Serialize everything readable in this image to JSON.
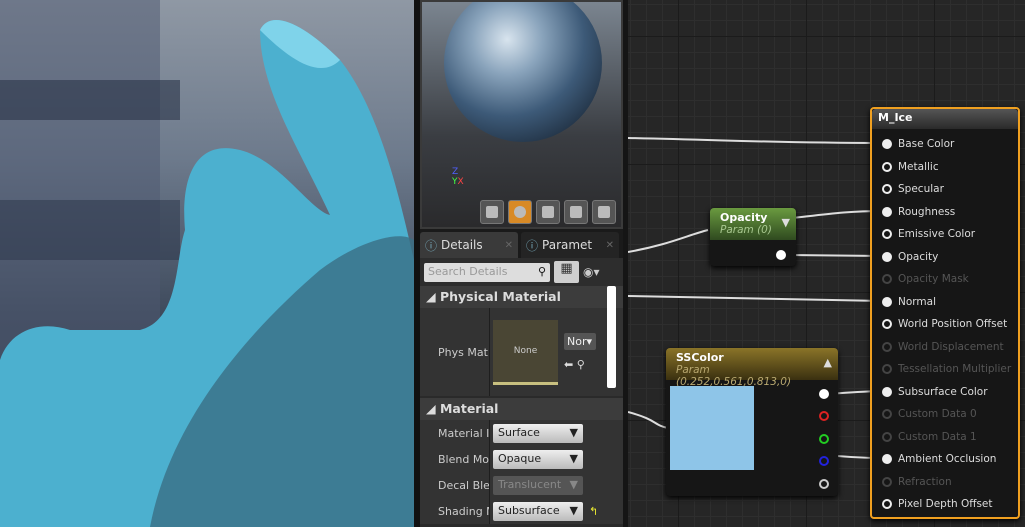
{
  "viewport": {
    "axis_z": "Z",
    "axis_x": "X",
    "axis_y": "Y"
  },
  "details": {
    "tabs": [
      {
        "label": "Details"
      },
      {
        "label": "Paramet"
      }
    ],
    "search_placeholder": "Search Details",
    "physical_material": {
      "title": "Physical Material",
      "prop_label": "Phys Mat",
      "thumb": "None",
      "combo": "Nor"
    },
    "material": {
      "title": "Material",
      "props": [
        {
          "label": "Material I",
          "value": "Surface"
        },
        {
          "label": "Blend Mo",
          "value": "Opaque"
        },
        {
          "label": "Decal Ble",
          "value": "Translucent"
        },
        {
          "label": "Shading M",
          "value": "Subsurface"
        }
      ]
    }
  },
  "graph": {
    "opacity_node": {
      "title": "Opacity",
      "subtitle": "Param (0)"
    },
    "sscolor_node": {
      "title": "SSColor",
      "subtitle": "Param (0.252,0.561,0.813,0)",
      "color": "#8ec5e8"
    },
    "result_node": {
      "title": "M_Ice",
      "pins": [
        {
          "label": "Base Color",
          "state": "connected"
        },
        {
          "label": "Metallic",
          "state": "enabled"
        },
        {
          "label": "Specular",
          "state": "enabled"
        },
        {
          "label": "Roughness",
          "state": "connected"
        },
        {
          "label": "Emissive Color",
          "state": "enabled"
        },
        {
          "label": "Opacity",
          "state": "connected"
        },
        {
          "label": "Opacity Mask",
          "state": "disabled"
        },
        {
          "label": "Normal",
          "state": "connected"
        },
        {
          "label": "World Position Offset",
          "state": "enabled"
        },
        {
          "label": "World Displacement",
          "state": "disabled"
        },
        {
          "label": "Tessellation Multiplier",
          "state": "disabled"
        },
        {
          "label": "Subsurface Color",
          "state": "connected"
        },
        {
          "label": "Custom Data 0",
          "state": "disabled"
        },
        {
          "label": "Custom Data 1",
          "state": "disabled"
        },
        {
          "label": "Ambient Occlusion",
          "state": "connected"
        },
        {
          "label": "Refraction",
          "state": "disabled"
        },
        {
          "label": "Pixel Depth Offset",
          "state": "enabled"
        }
      ]
    }
  }
}
